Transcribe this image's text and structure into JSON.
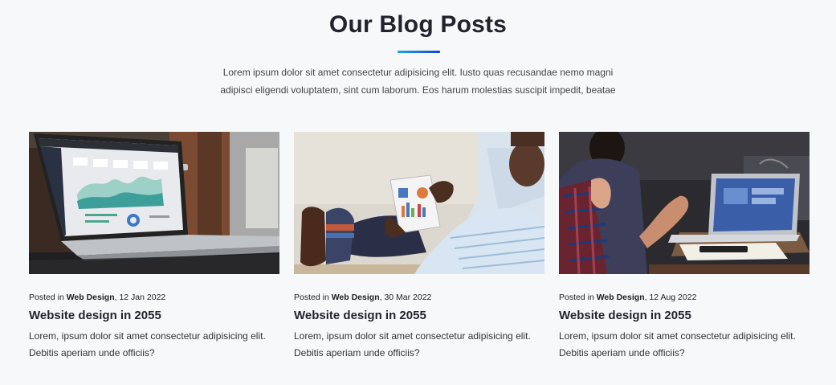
{
  "section": {
    "title": "Our Blog Posts",
    "description_line1": "Lorem ipsum dolor sit amet consectetur adipisicing elit. Iusto quas recusandae nemo magni",
    "description_line2": "adipisci eligendi voluptatem, sint cum laborum. Eos harum molestias suscipit impedit, beatae",
    "accent_gradient": [
      "#19a7e8",
      "#1a3fd6"
    ]
  },
  "posts": [
    {
      "posted_in_prefix": "Posted in ",
      "category": "Web Design",
      "date": ", 12 Jan 2022",
      "title": "Website design in 2055",
      "excerpt_line1": "Lorem, ipsum dolor sit amet consectetur adipisicing elit.",
      "excerpt_line2": "Debitis aperiam unde officiis?",
      "image": "laptop-dashboard-photo"
    },
    {
      "posted_in_prefix": "Posted in ",
      "category": "Web Design",
      "date": ", 30 Mar 2022",
      "title": "Website design in 2055",
      "excerpt_line1": "Lorem, ipsum dolor sit amet consectetur adipisicing elit.",
      "excerpt_line2": "Debitis aperiam unde officiis?",
      "image": "tablet-charts-photo"
    },
    {
      "posted_in_prefix": "Posted in ",
      "category": "Web Design",
      "date": ", 12 Aug 2022",
      "title": "Website design in 2055",
      "excerpt_line1": "Lorem, ipsum dolor sit amet consectetur adipisicing elit.",
      "excerpt_line2": "Debitis aperiam unde officiis?",
      "image": "meeting-laptop-photo"
    }
  ]
}
